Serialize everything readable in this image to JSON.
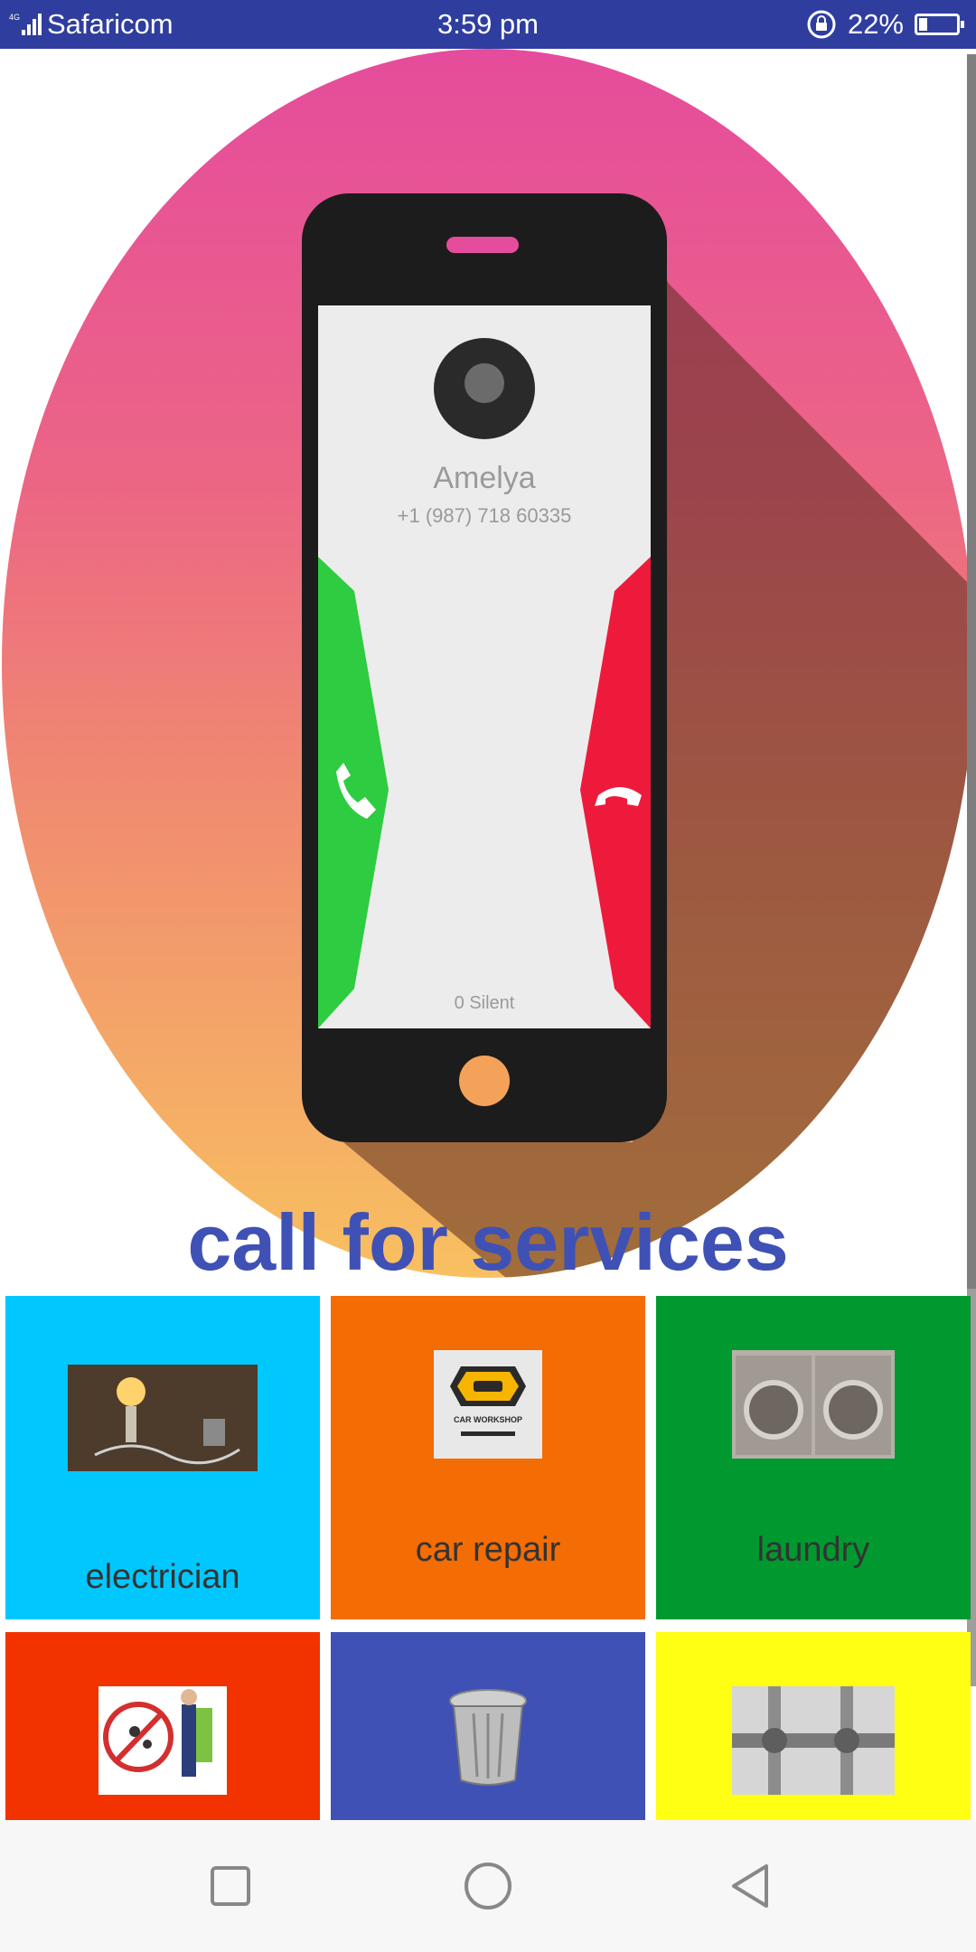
{
  "status_bar": {
    "carrier": "Safaricom",
    "time": "3:59 pm",
    "battery_percent": "22%",
    "battery_level": 0.22,
    "icons": [
      "signal-icon",
      "screen-lock-rotation-icon",
      "battery-icon"
    ]
  },
  "hero": {
    "title": "call for services",
    "phone_screen": {
      "contact_name": "Amelya",
      "contact_number": "+1 (987) 718 60335",
      "footer": "0 Silent",
      "icons": [
        "accept-call-icon",
        "decline-call-icon",
        "home-button-icon"
      ]
    }
  },
  "services": [
    {
      "label": "electrician",
      "color": "#00c8ff",
      "icon": "electrician-icon"
    },
    {
      "label": "car repair",
      "color": "#f36c04",
      "icon": "car-workshop-icon",
      "badge_text": "CAR WORKSHOP"
    },
    {
      "label": "laundry",
      "color": "#00992f",
      "icon": "washing-machine-icon"
    },
    {
      "label": "",
      "color": "#f23300",
      "icon": "pest-control-icon"
    },
    {
      "label": "",
      "color": "#3f51b5",
      "icon": "trash-can-icon"
    },
    {
      "label": "",
      "color": "#ffff14",
      "icon": "plumbing-pipes-icon"
    }
  ],
  "nav_bar": {
    "buttons": [
      "recent-apps-button",
      "home-button",
      "back-button"
    ]
  },
  "colors": {
    "status_bar": "#2f3e9e",
    "accent": "#3f51b5",
    "nav_bar": "#f7f7f7"
  }
}
